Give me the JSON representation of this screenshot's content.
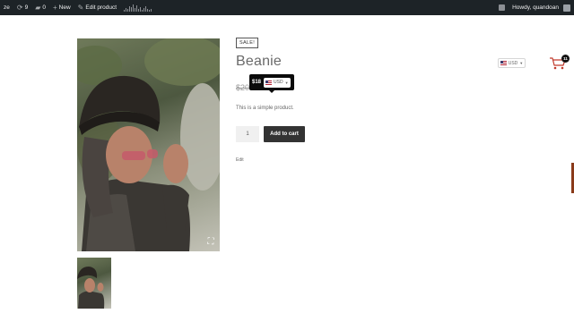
{
  "adminbar": {
    "site_label": "ze",
    "views_count": "9",
    "comments_count": "0",
    "new_label": "New",
    "edit_product_label": "Edit product",
    "user_greeting": "Howdy, quandoan"
  },
  "product": {
    "sale_badge": "SALE!",
    "title": "Beanie",
    "old_price": "$20",
    "new_price": "$18",
    "description": "This is a simple product.",
    "quantity": "1",
    "add_to_cart_label": "Add to cart",
    "edit_link": "Edit"
  },
  "currency_switcher": {
    "tooltip_currency": "USD",
    "header_currency": "USD"
  },
  "cart": {
    "count": "11"
  },
  "colors": {
    "adminbar_bg": "#1d2327",
    "button_bg": "#333333",
    "tooltip_bg": "#0b0b0b"
  }
}
